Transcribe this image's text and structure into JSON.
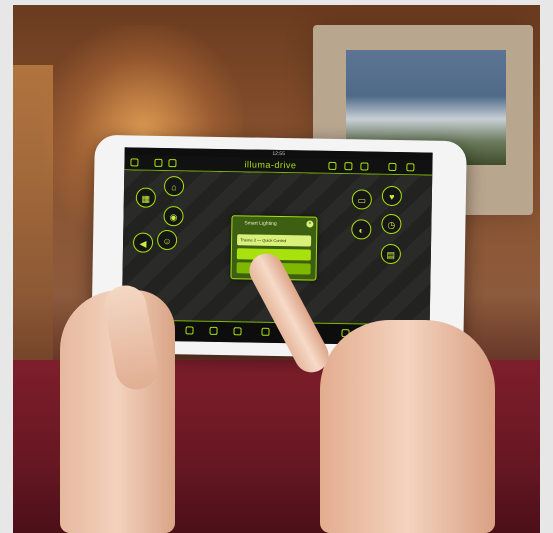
{
  "tablet": {
    "status_time": "12:55",
    "brand": "illuma-drive",
    "popup": {
      "title": "Smart Lighting",
      "row1": "Theme 3 — Quick Control"
    }
  },
  "colors": {
    "accent": "#a8e10c",
    "screen_bg": "#1b1c1a",
    "popup_bg": "#3c5f12"
  },
  "icons": [
    "lightbulb-icon",
    "home-icon",
    "speaker-icon",
    "heart-icon",
    "lock-icon",
    "settings-icon"
  ]
}
